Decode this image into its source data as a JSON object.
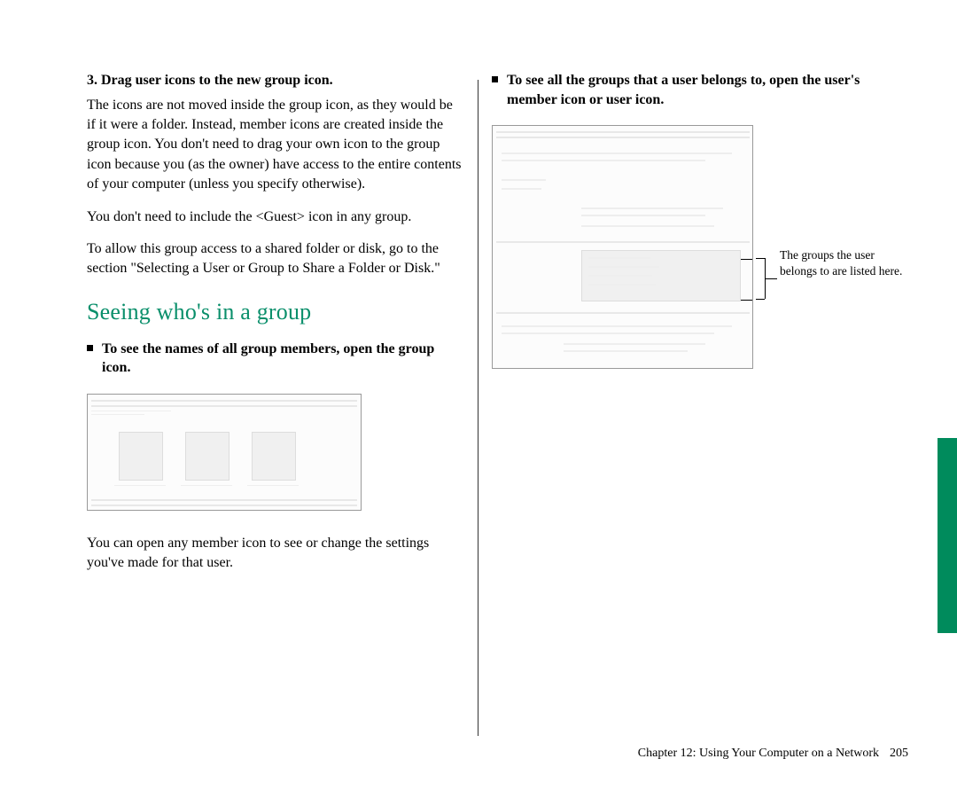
{
  "left": {
    "step3_heading": "3.  Drag user icons to the new group icon.",
    "para1": "The icons are not moved inside the group icon, as they would be if it were a folder. Instead, member icons are created inside the group icon. You don't need to drag your own icon to the group icon because you (as the owner) have access to the entire contents of your computer (unless you specify otherwise).",
    "para2": "You don't need to include the <Guest> icon in any group.",
    "para3": "To allow this group access to a shared folder or disk, go to the section \"Selecting a User or Group to Share a Folder or Disk.\"",
    "section_heading": "Seeing who's in a group",
    "bullet1": "To see the names of all group members, open the group icon.",
    "para4": "You can open any member icon to see or change the settings you've made for that user."
  },
  "right": {
    "bullet1": "To see all the groups that a user belongs to, open the user's member icon or user icon.",
    "callout": "The groups the user belongs to are listed here."
  },
  "footer": {
    "chapter": "Chapter 12: Using Your Computer on a Network",
    "page": "205"
  }
}
